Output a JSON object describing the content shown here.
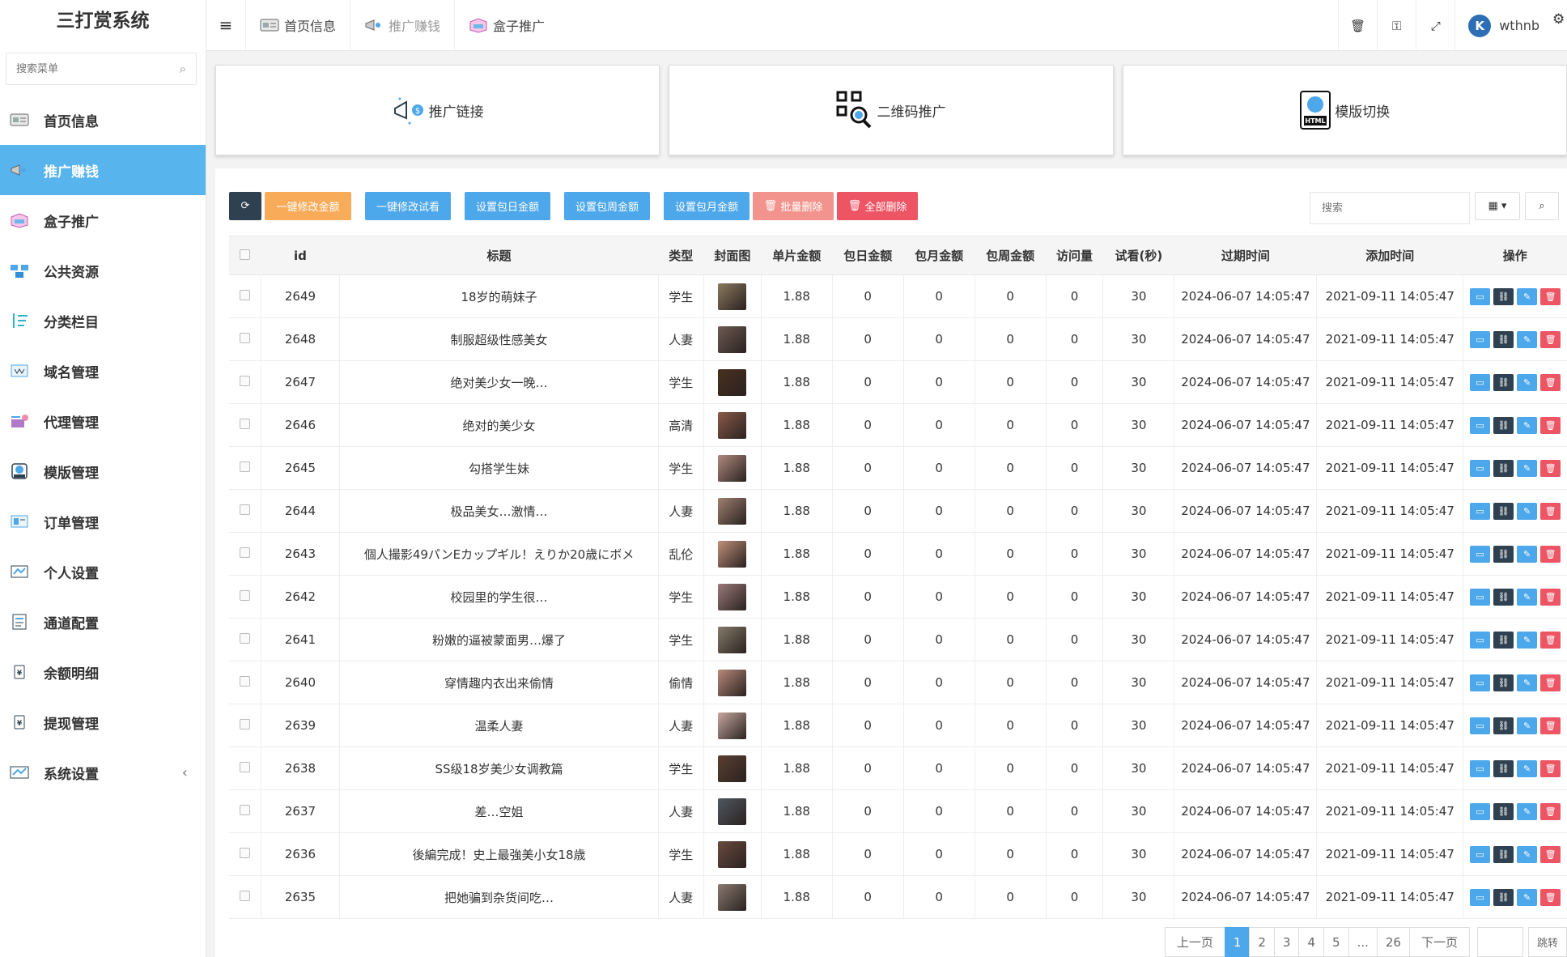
{
  "app": {
    "title": "三打赏系统"
  },
  "sidebar": {
    "search_placeholder": "搜索菜单",
    "items": [
      {
        "label": "首页信息",
        "icon": "id-card-icon"
      },
      {
        "label": "推广赚钱",
        "icon": "megaphone-icon",
        "active": true
      },
      {
        "label": "盒子推广",
        "icon": "box-icon"
      },
      {
        "label": "公共资源",
        "icon": "network-icon"
      },
      {
        "label": "分类栏目",
        "icon": "sort-icon"
      },
      {
        "label": "域名管理",
        "icon": "domain-icon"
      },
      {
        "label": "代理管理",
        "icon": "agent-icon"
      },
      {
        "label": "模版管理",
        "icon": "template-icon"
      },
      {
        "label": "订单管理",
        "icon": "order-icon"
      },
      {
        "label": "个人设置",
        "icon": "profile-icon"
      },
      {
        "label": "通道配置",
        "icon": "channel-icon"
      },
      {
        "label": "余额明细",
        "icon": "balance-icon"
      },
      {
        "label": "提现管理",
        "icon": "withdraw-icon"
      },
      {
        "label": "系统设置",
        "icon": "settings-icon",
        "caret": "‹"
      }
    ]
  },
  "topbar": {
    "tabs": [
      {
        "label": "首页信息",
        "icon": "id-card-icon"
      },
      {
        "label": "推广赚钱",
        "icon": "megaphone-icon"
      },
      {
        "label": "盒子推广",
        "icon": "box-icon"
      }
    ],
    "username": "wthnb"
  },
  "cards": [
    {
      "label": "推广链接",
      "icon": "promo-link-icon"
    },
    {
      "label": "二维码推广",
      "icon": "qr-search-icon"
    },
    {
      "label": "模版切换",
      "icon": "html-template-icon"
    }
  ],
  "toolbar": {
    "buttons": [
      "一键修改金额",
      "一键修改试看",
      "设置包日金额",
      "设置包周金额",
      "设置包月金额",
      "批量删除",
      "全部删除"
    ],
    "search_placeholder": "搜索"
  },
  "table": {
    "headers": [
      "id",
      "标题",
      "类型",
      "封面图",
      "单片金额",
      "包日金额",
      "包月金额",
      "包周金额",
      "访问量",
      "试看(秒)",
      "过期时间",
      "添加时间",
      "操作"
    ],
    "rows": [
      {
        "id": "2649",
        "title": "18岁的萌妹子",
        "type": "学生",
        "price": "1.88",
        "daily": "0",
        "monthly": "0",
        "weekly": "0",
        "visits": "0",
        "trial": "30",
        "expire": "2024-06-07 14:05:47",
        "added": "2021-09-11 14:05:47",
        "thumb": "#8b7a5e"
      },
      {
        "id": "2648",
        "title": "制服超级性感美女",
        "type": "人妻",
        "price": "1.88",
        "daily": "0",
        "monthly": "0",
        "weekly": "0",
        "visits": "0",
        "trial": "30",
        "expire": "2024-06-07 14:05:47",
        "added": "2021-09-11 14:05:47",
        "thumb": "#6e5a52"
      },
      {
        "id": "2647",
        "title": "绝对美少女一晚…",
        "type": "学生",
        "price": "1.88",
        "daily": "0",
        "monthly": "0",
        "weekly": "0",
        "visits": "0",
        "trial": "30",
        "expire": "2024-06-07 14:05:47",
        "added": "2021-09-11 14:05:47",
        "thumb": "#4a3020"
      },
      {
        "id": "2646",
        "title": "绝对的美少女",
        "type": "高清",
        "price": "1.88",
        "daily": "0",
        "monthly": "0",
        "weekly": "0",
        "visits": "0",
        "trial": "30",
        "expire": "2024-06-07 14:05:47",
        "added": "2021-09-11 14:05:47",
        "thumb": "#8a5a48"
      },
      {
        "id": "2645",
        "title": "勾搭学生妹",
        "type": "学生",
        "price": "1.88",
        "daily": "0",
        "monthly": "0",
        "weekly": "0",
        "visits": "0",
        "trial": "30",
        "expire": "2024-06-07 14:05:47",
        "added": "2021-09-11 14:05:47",
        "thumb": "#b08a80"
      },
      {
        "id": "2644",
        "title": "极品美女…激情…",
        "type": "人妻",
        "price": "1.88",
        "daily": "0",
        "monthly": "0",
        "weekly": "0",
        "visits": "0",
        "trial": "30",
        "expire": "2024-06-07 14:05:47",
        "added": "2021-09-11 14:05:47",
        "thumb": "#a08070"
      },
      {
        "id": "2643",
        "title": "個人撮影49パンEカップギル！えりか20歳にボメ",
        "type": "乱伦",
        "price": "1.88",
        "daily": "0",
        "monthly": "0",
        "weekly": "0",
        "visits": "0",
        "trial": "30",
        "expire": "2024-06-07 14:05:47",
        "added": "2021-09-11 14:05:47",
        "thumb": "#c0907a"
      },
      {
        "id": "2642",
        "title": "校园里的学生很…",
        "type": "学生",
        "price": "1.88",
        "daily": "0",
        "monthly": "0",
        "weekly": "0",
        "visits": "0",
        "trial": "30",
        "expire": "2024-06-07 14:05:47",
        "added": "2021-09-11 14:05:47",
        "thumb": "#9a7a78"
      },
      {
        "id": "2641",
        "title": "粉嫩的逼被蒙面男…爆了",
        "type": "学生",
        "price": "1.88",
        "daily": "0",
        "monthly": "0",
        "weekly": "0",
        "visits": "0",
        "trial": "30",
        "expire": "2024-06-07 14:05:47",
        "added": "2021-09-11 14:05:47",
        "thumb": "#857a6a"
      },
      {
        "id": "2640",
        "title": "穿情趣内衣出来偷情",
        "type": "偷情",
        "price": "1.88",
        "daily": "0",
        "monthly": "0",
        "weekly": "0",
        "visits": "0",
        "trial": "30",
        "expire": "2024-06-07 14:05:47",
        "added": "2021-09-11 14:05:47",
        "thumb": "#b88a7a"
      },
      {
        "id": "2639",
        "title": "温柔人妻",
        "type": "人妻",
        "price": "1.88",
        "daily": "0",
        "monthly": "0",
        "weekly": "0",
        "visits": "0",
        "trial": "30",
        "expire": "2024-06-07 14:05:47",
        "added": "2021-09-11 14:05:47",
        "thumb": "#c8a8a0"
      },
      {
        "id": "2638",
        "title": "SS级18岁美少女调教篇",
        "type": "学生",
        "price": "1.88",
        "daily": "0",
        "monthly": "0",
        "weekly": "0",
        "visits": "0",
        "trial": "30",
        "expire": "2024-06-07 14:05:47",
        "added": "2021-09-11 14:05:47",
        "thumb": "#5a4030"
      },
      {
        "id": "2637",
        "title": "差…空姐",
        "type": "人妻",
        "price": "1.88",
        "daily": "0",
        "monthly": "0",
        "weekly": "0",
        "visits": "0",
        "trial": "30",
        "expire": "2024-06-07 14:05:47",
        "added": "2021-09-11 14:05:47",
        "thumb": "#505860"
      },
      {
        "id": "2636",
        "title": "後編完成！史上最強美小女18歳",
        "type": "学生",
        "price": "1.88",
        "daily": "0",
        "monthly": "0",
        "weekly": "0",
        "visits": "0",
        "trial": "30",
        "expire": "2024-06-07 14:05:47",
        "added": "2021-09-11 14:05:47",
        "thumb": "#6a4a40"
      },
      {
        "id": "2635",
        "title": "把她骗到杂货间吃…",
        "type": "人妻",
        "price": "1.88",
        "daily": "0",
        "monthly": "0",
        "weekly": "0",
        "visits": "0",
        "trial": "30",
        "expire": "2024-06-07 14:05:47",
        "added": "2021-09-11 14:05:47",
        "thumb": "#8a7a70"
      }
    ]
  },
  "pagination": {
    "prev": "上一页",
    "pages": [
      "1",
      "2",
      "3",
      "4",
      "5",
      "...",
      "26"
    ],
    "current": "1",
    "next": "下一页",
    "go": "跳转"
  },
  "colors": {
    "accent": "#58b4ec",
    "dark": "#2f4050",
    "warning": "#f8ac59",
    "danger": "#ed5565",
    "primary": "#4da7eb"
  }
}
